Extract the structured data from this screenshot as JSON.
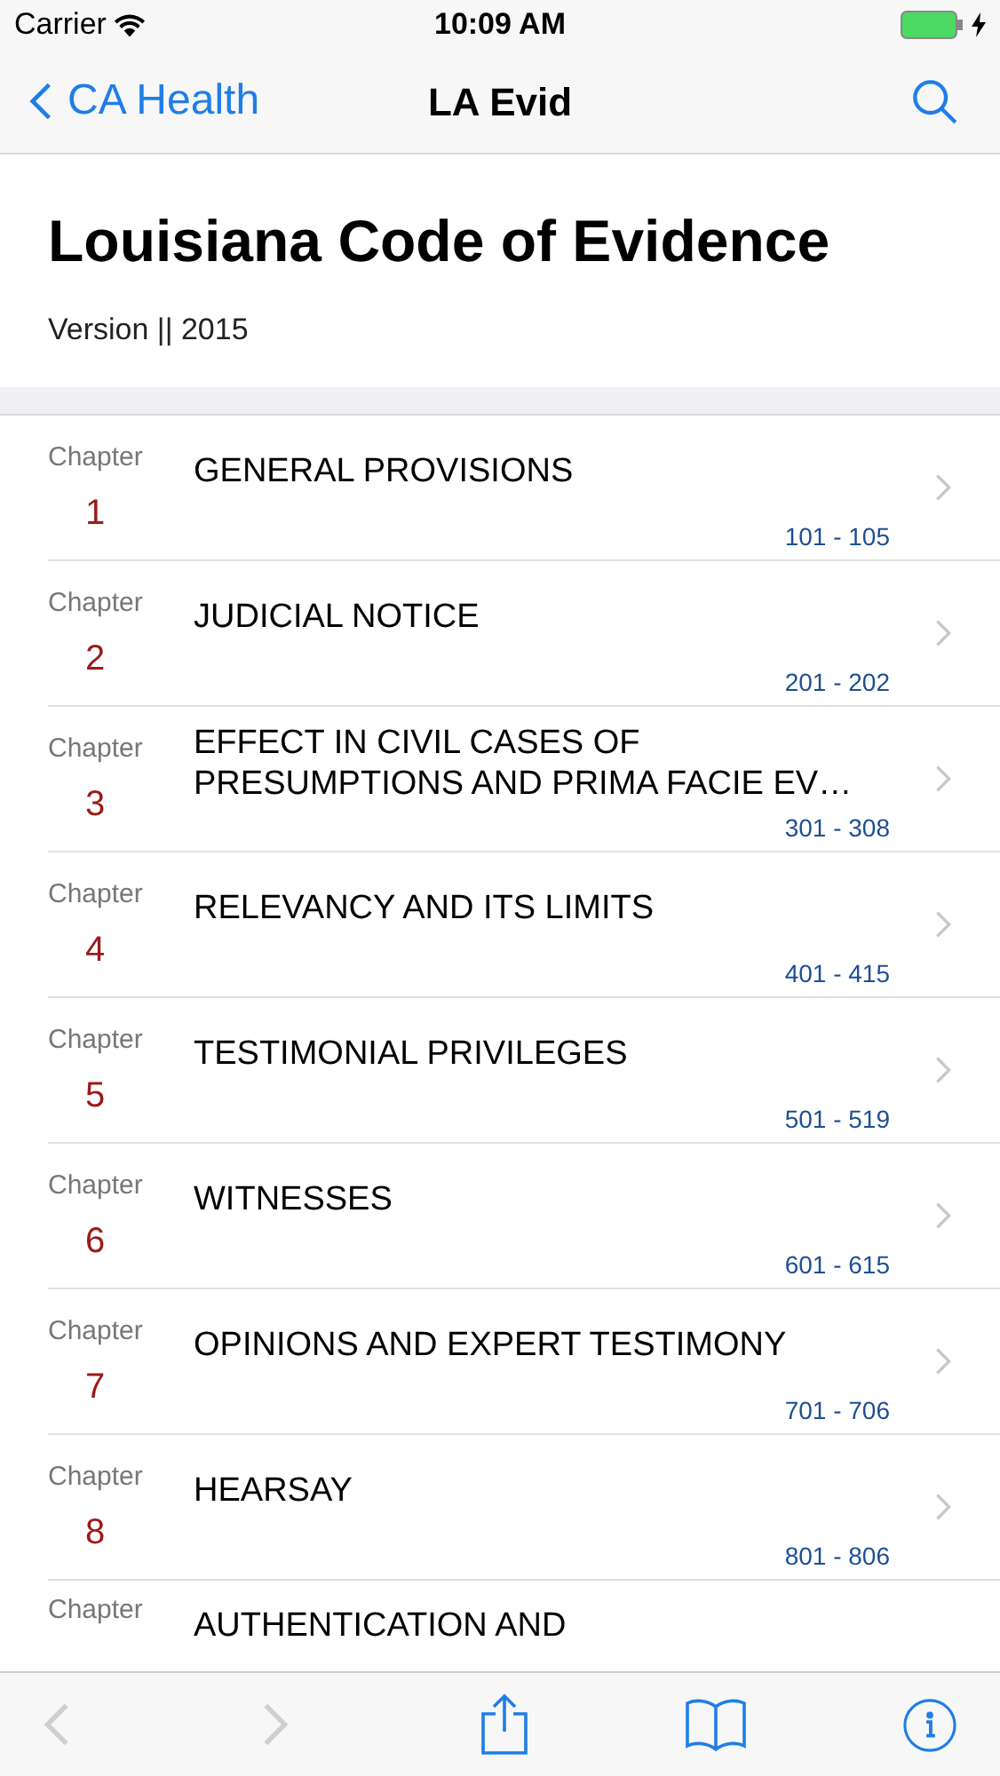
{
  "status_bar": {
    "carrier": "Carrier",
    "time": "10:09 AM"
  },
  "nav": {
    "back_label": "CA Health",
    "title": "LA Evid"
  },
  "header": {
    "title": "Louisiana Code of Evidence",
    "version": "Version || 2015"
  },
  "chapters": [
    {
      "label": "Chapter",
      "number": "1",
      "title": "GENERAL PROVISIONS",
      "range": "101 - 105"
    },
    {
      "label": "Chapter",
      "number": "2",
      "title": "JUDICIAL NOTICE",
      "range": "201 - 202"
    },
    {
      "label": "Chapter",
      "number": "3",
      "title": "EFFECT IN CIVIL CASES OF PRESUMPTIONS AND PRIMA FACIE EV…",
      "range": "301 - 308"
    },
    {
      "label": "Chapter",
      "number": "4",
      "title": "RELEVANCY AND ITS LIMITS",
      "range": "401 - 415"
    },
    {
      "label": "Chapter",
      "number": "5",
      "title": "TESTIMONIAL PRIVILEGES",
      "range": "501 - 519"
    },
    {
      "label": "Chapter",
      "number": "6",
      "title": "WITNESSES",
      "range": "601 - 615"
    },
    {
      "label": "Chapter",
      "number": "7",
      "title": "OPINIONS AND EXPERT TESTIMONY",
      "range": "701 - 706"
    },
    {
      "label": "Chapter",
      "number": "8",
      "title": "HEARSAY",
      "range": "801 - 806"
    },
    {
      "label": "Chapter",
      "title": "AUTHENTICATION AND"
    }
  ],
  "toolbar": {
    "back_disabled": true,
    "forward_disabled": true
  }
}
